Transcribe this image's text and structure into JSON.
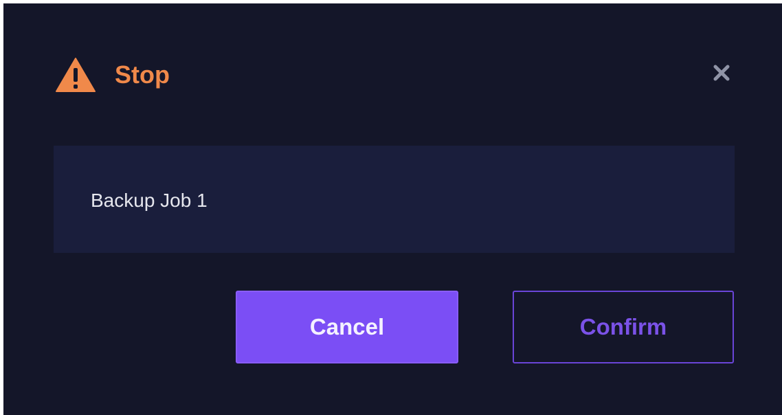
{
  "dialog": {
    "title": "Stop",
    "icon": "warning-triangle-icon",
    "close_icon": "close-icon",
    "accent_color": "#f0894a"
  },
  "content": {
    "item_label": "Backup Job 1"
  },
  "actions": {
    "cancel_label": "Cancel",
    "confirm_label": "Confirm",
    "primary_color": "#7b4ef5"
  }
}
